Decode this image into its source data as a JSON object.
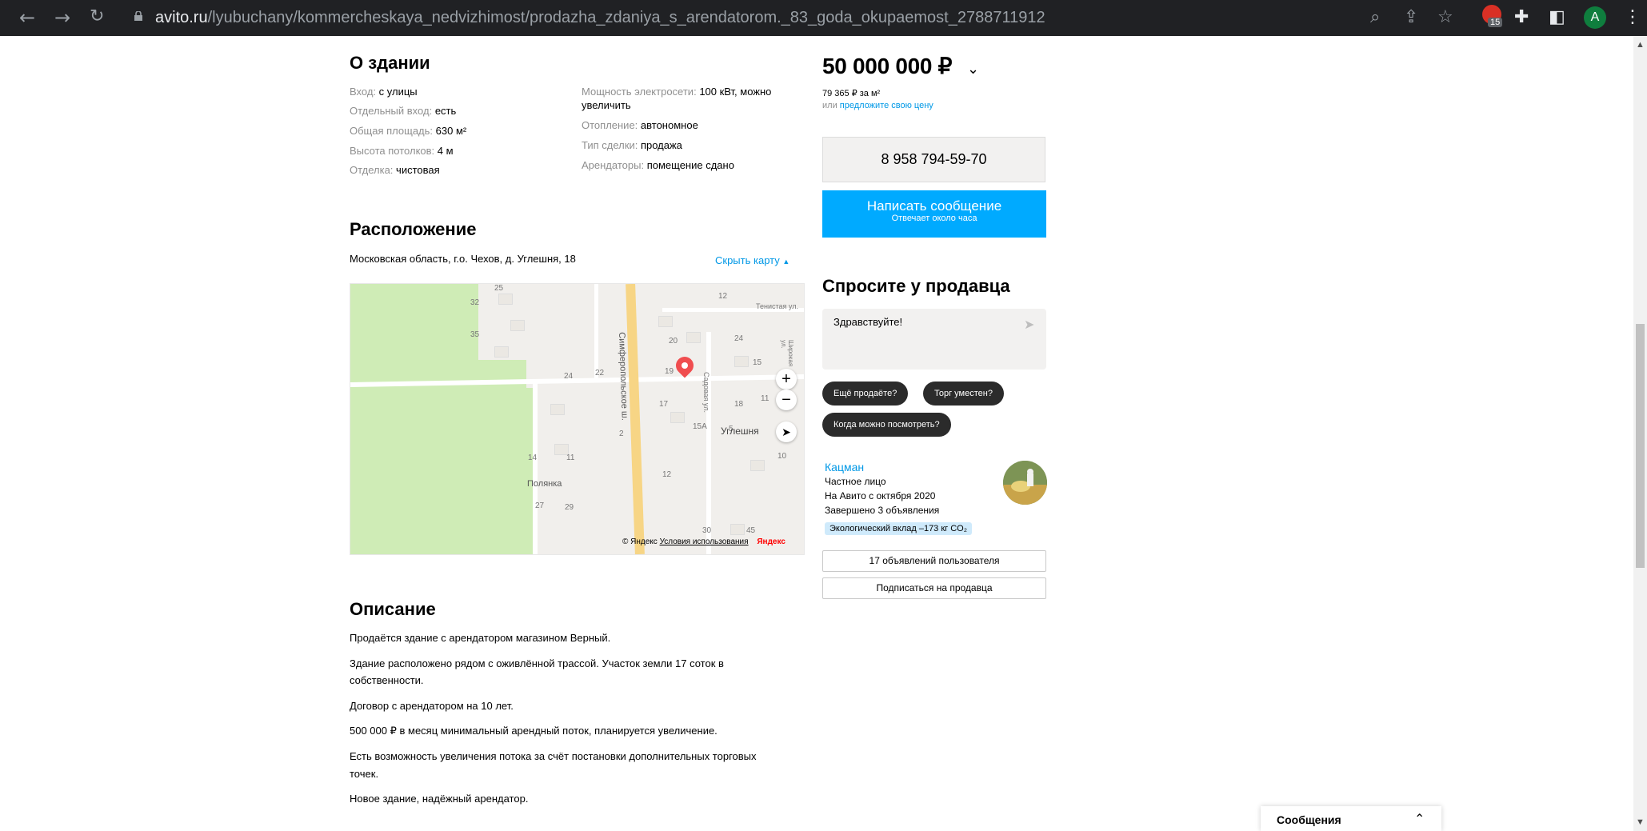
{
  "browser": {
    "url_domain": "avito.ru",
    "url_path": "/lyubuchany/kommercheskaya_nedvizhimost/prodazha_zdaniya_s_arendatorom._83_goda_okupaemost_2788711912",
    "profile_initial": "A",
    "extension_badge": "15",
    "icons": [
      "back-icon",
      "forward-icon",
      "reload-icon",
      "lock-icon",
      "zoom-icon",
      "share-icon",
      "star-icon",
      "extensions-icon",
      "sidebar-icon",
      "menu-icon"
    ]
  },
  "about": {
    "title": "О здании",
    "left": [
      {
        "label": "Вход:",
        "value": "с улицы"
      },
      {
        "label": "Отдельный вход:",
        "value": "есть"
      },
      {
        "label": "Общая площадь:",
        "value": "630 м²"
      },
      {
        "label": "Высота потолков:",
        "value": "4 м"
      },
      {
        "label": "Отделка:",
        "value": "чистовая"
      }
    ],
    "right": [
      {
        "label": "Мощность электросети:",
        "value": "100 кВт, можно",
        "value2": "увеличить"
      },
      {
        "label": "Отопление:",
        "value": "автономное"
      },
      {
        "label": "Тип сделки:",
        "value": "продажа"
      },
      {
        "label": "Арендаторы:",
        "value": "помещение сдано"
      }
    ]
  },
  "location": {
    "title": "Расположение",
    "address": "Московская область, г.о. Чехов, д. Углешня, 18",
    "hide_map": "Скрыть карту",
    "map": {
      "labels": {
        "highway": "Симферопольское ш.",
        "village": "Углешня",
        "polyanka": "Полянка",
        "street1": "Тенистая ул.",
        "street2": "Садовая ул.",
        "street3": "Широкая ул."
      },
      "house_numbers": [
        "25",
        "32",
        "35",
        "24",
        "22",
        "19",
        "12",
        "20",
        "24",
        "15",
        "17",
        "18",
        "11",
        "15А",
        "5",
        "2",
        "12",
        "14",
        "11",
        "27",
        "29",
        "30",
        "45",
        "10"
      ],
      "zoom_in": "+",
      "zoom_out": "−",
      "copyright": "© Яндекс",
      "terms": "Условия использования",
      "brand": "Яндекс"
    }
  },
  "description": {
    "title": "Описание",
    "paragraphs": [
      "Продаётся здание с арендатором магазином Верный.",
      "Здание расположено рядом с оживлённой трассой. Участок земли 17 соток в",
      "собственности.",
      "Договор с арендатором на 10 лет.",
      "500 000 ₽ в месяц минимальный арендный поток, планируется увеличение.",
      "Есть возможность увеличения потока за счёт постановки дополнительных торговых",
      "точек.",
      "Новое здание, надёжный арендатор."
    ]
  },
  "sidebar": {
    "price": "50 000 000 ₽",
    "price_per_meter": "79 365 ₽ за м²",
    "suggest_prefix": "или",
    "suggest_link": "предложите свою цену",
    "phone": "8 958 794-59-70",
    "message_btn": "Написать сообщение",
    "message_sub": "Отвечает около часа",
    "ask_title": "Спросите у продавца",
    "ask_text": "Здравствуйте!",
    "chips": [
      "Ещё продаёте?",
      "Торг уместен?",
      "Когда можно посмотреть?"
    ],
    "seller": {
      "name": "Кацман",
      "type": "Частное лицо",
      "since": "На Авито с октября 2020",
      "completed": "Завершено 3 объявления",
      "eco": "Экологический вклад –173 кг CO₂"
    },
    "ads_btn": "17 объявлений пользователя",
    "subscribe_btn": "Подписаться на продавца"
  },
  "messenger": {
    "title": "Сообщения"
  }
}
